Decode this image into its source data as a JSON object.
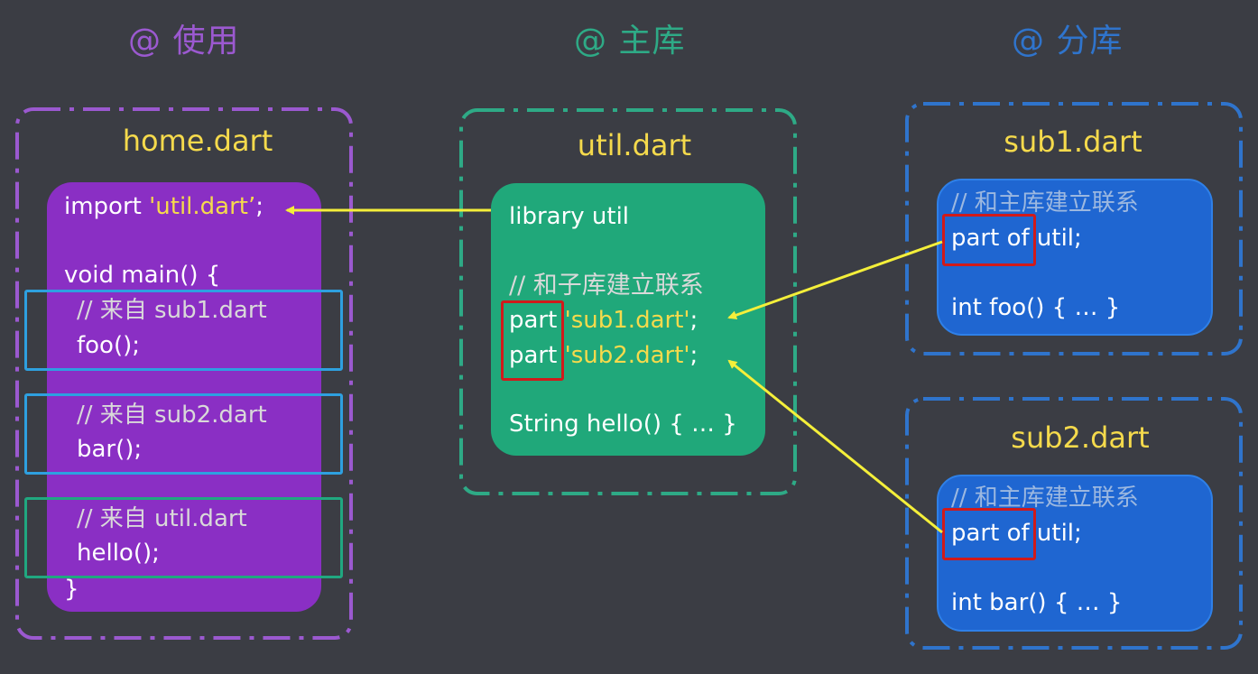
{
  "headings": {
    "use": "@ 使用",
    "main_lib": "@ 主库",
    "sub_lib": "@ 分库"
  },
  "home": {
    "filename": "home.dart",
    "import_kw": "import ",
    "import_str": "'util.dart’",
    "import_end": ";",
    "main_decl": "void main() {",
    "c1": "// 来自 sub1.dart",
    "call1": "foo();",
    "c2": "// 来自 sub2.dart",
    "call2": "bar();",
    "c3": "// 来自 util.dart",
    "call3": "hello();",
    "close": "}"
  },
  "util": {
    "filename": "util.dart",
    "library": "library util",
    "comment": "// 和子库建立联系",
    "part_kw": "part ",
    "part1_str": "'sub1.dart'",
    "part2_str": "'sub2.dart'",
    "semi": ";",
    "hello": "String hello() { … }"
  },
  "sub1": {
    "filename": "sub1.dart",
    "comment": "// 和主库建立联系",
    "part_of": "part of util;",
    "func": "int foo() { … }"
  },
  "sub2": {
    "filename": "sub2.dart",
    "comment": "// 和主库建立联系",
    "part_of": "part of util;",
    "func": "int bar() { … }"
  },
  "colors": {
    "background": "#3b3d44",
    "use": "#9b59d0",
    "main_lib": "#2eaa86",
    "sub_lib": "#2f74cc",
    "home_panel": "#8a2fc4",
    "util_panel": "#20a87a",
    "sub_panel": "#1f66d1",
    "string": "#f5da4c",
    "arrow": "#f4ef3a",
    "highlight": "#d11a1a",
    "blue_box": "#2ea0e0",
    "green_box": "#20a880"
  }
}
